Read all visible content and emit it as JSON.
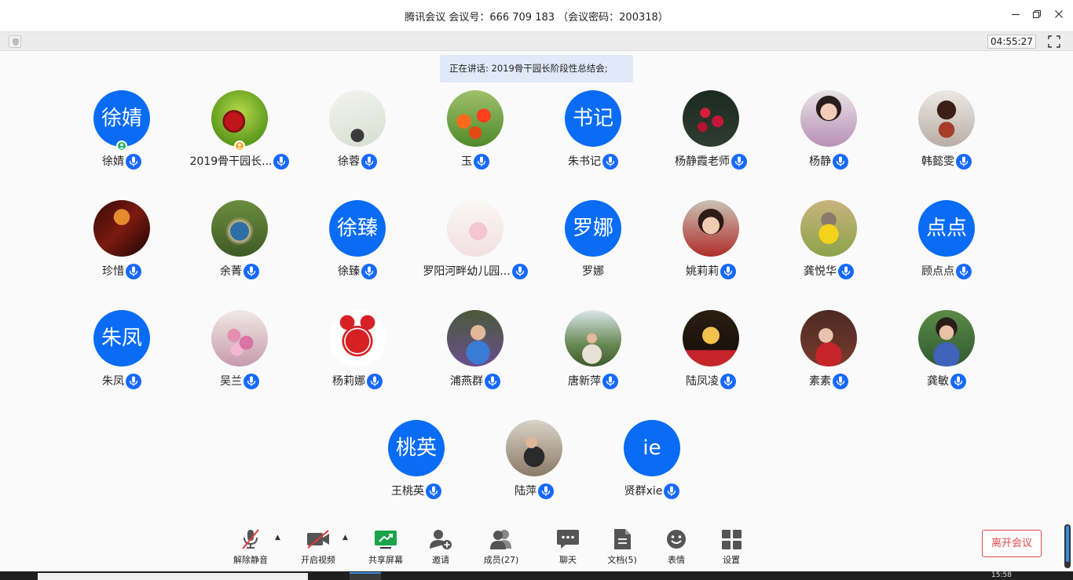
{
  "window": {
    "title": "腾讯会议 会议号：666 709 183 （会议密码：200318）",
    "timer": "04:55:27",
    "speaking": "正在讲话: 2019骨干园长阶段性总结会;"
  },
  "participants": [
    {
      "name": "徐婧",
      "avatar_text": "徐婧",
      "badge": "#23b26d"
    },
    {
      "name": "2019骨干园长...",
      "avatar_icon": "cherry-photo",
      "badge": "#f5a623"
    },
    {
      "name": "徐蓉",
      "avatar_icon": "bonsai-photo"
    },
    {
      "name": "玉",
      "avatar_icon": "tulips-photo"
    },
    {
      "name": "朱书记",
      "avatar_text": "书记"
    },
    {
      "name": "杨静霞老师",
      "avatar_icon": "red-flowers-photo"
    },
    {
      "name": "杨静",
      "avatar_icon": "woman-portrait-photo"
    },
    {
      "name": "韩懿雯",
      "avatar_icon": "doll-photo"
    },
    {
      "name": "珍惜",
      "avatar_icon": "butterfly-photo"
    },
    {
      "name": "余菁",
      "avatar_icon": "hobbit-door-photo"
    },
    {
      "name": "徐臻",
      "avatar_text": "徐臻"
    },
    {
      "name": "罗阳河畔幼儿园...",
      "avatar_icon": "sketch-girl-photo"
    },
    {
      "name": "罗娜",
      "avatar_text": "罗娜",
      "no_mic": true
    },
    {
      "name": "姚莉莉",
      "avatar_icon": "child-portrait-photo"
    },
    {
      "name": "龚悦华",
      "avatar_icon": "bunny-eggs-photo"
    },
    {
      "name": "顾点点",
      "avatar_text": "点点"
    },
    {
      "name": "朱凤",
      "avatar_text": "朱凤"
    },
    {
      "name": "吴兰",
      "avatar_icon": "roses-photo"
    },
    {
      "name": "杨莉娜",
      "avatar_icon": "paper-cut-photo"
    },
    {
      "name": "浦燕群",
      "avatar_icon": "woman-lavender-photo"
    },
    {
      "name": "唐新萍",
      "avatar_icon": "woman-mountain-photo"
    },
    {
      "name": "陆凤凌",
      "avatar_icon": "golden-deer-photo"
    },
    {
      "name": "素素",
      "avatar_icon": "woman-red-photo"
    },
    {
      "name": "龚敏",
      "avatar_icon": "woman-garden-photo"
    },
    {
      "name": "王桃英",
      "avatar_text": "桃英"
    },
    {
      "name": "陆萍",
      "avatar_icon": "sitting-woman-photo"
    },
    {
      "name": "贤群xie",
      "avatar_text": "ie"
    }
  ],
  "controls": {
    "unmute": "解除静音",
    "video": "开启视频",
    "share": "共享屏幕",
    "invite": "邀请",
    "members": "成员(27)",
    "chat": "聊天",
    "docs": "文档(5)",
    "emoji": "表情",
    "settings": "设置",
    "leave": "离开会议"
  },
  "taskbar": {
    "clock": "15:58"
  },
  "colors": {
    "accent": "#0a6cf5",
    "leave": "#e0484a",
    "share": "#1aa34a"
  }
}
